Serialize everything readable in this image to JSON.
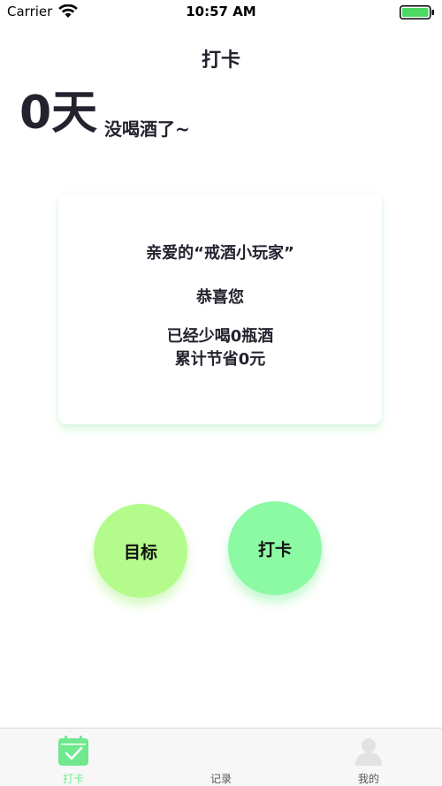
{
  "status_bar": {
    "carrier": "Carrier",
    "time": "10:57 AM"
  },
  "nav": {
    "title": "打卡"
  },
  "streak": {
    "days": "0天",
    "text": "没喝酒了~"
  },
  "card": {
    "greeting": "亲爱的“戒酒小玩家”",
    "congrats": "恭喜您",
    "bottles": "已经少喝0瓶酒",
    "savings": "累计节省0元"
  },
  "actions": {
    "goal_label": "目标",
    "checkin_label": "打卡"
  },
  "tab_bar": {
    "items": [
      {
        "label": "打卡",
        "icon": "calendar-check-icon",
        "active": true
      },
      {
        "label": "记录",
        "icon": "record-icon",
        "active": false
      },
      {
        "label": "我的",
        "icon": "user-icon",
        "active": false
      }
    ]
  },
  "colors": {
    "accent": "#6fe88e",
    "goal_button": "#b3fb8a",
    "checkin_button": "#8cf9a3",
    "battery": "#4cd964"
  }
}
